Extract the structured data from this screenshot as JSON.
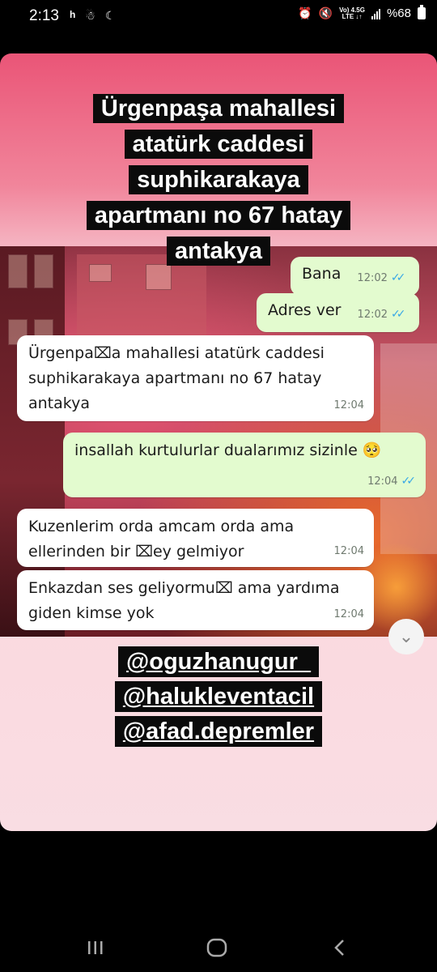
{
  "status_bar": {
    "time": "2:13",
    "network_top": "Vo) 4.5G",
    "network_bottom": "LTE ↓↑",
    "battery": "%68",
    "icons": [
      "h-icon",
      "baby-icon",
      "moon-icon",
      "alarm-icon",
      "mute-icon",
      "signal-icon",
      "battery-icon"
    ]
  },
  "story": {
    "title_lines": [
      "Ürgenpaşa mahallesi",
      "atatürk caddesi",
      "suphikarakaya",
      "apartmanı no 67 hatay",
      "antakya"
    ],
    "chat": {
      "messages": [
        {
          "dir": "out",
          "text": "Bana",
          "time": "12:02"
        },
        {
          "dir": "out",
          "text": "Adres ver",
          "time": "12:02"
        },
        {
          "dir": "in",
          "text": "Ürgenpa⌧a mahallesi atatürk caddesi suphikarakaya apartmanı no 67 hatay antakya",
          "time": "12:04"
        },
        {
          "dir": "out",
          "text": "insallah kurtulurlar dualarımız sizinle 🥺",
          "time": "12:04"
        },
        {
          "dir": "in",
          "text": "Kuzenlerim orda amcam orda ama ellerinden bir ⌧ey gelmiyor",
          "time": "12:04"
        },
        {
          "dir": "in",
          "text": "Enkazdan ses geliyormu⌧ ama yardıma giden kimse yok",
          "time": "12:04"
        }
      ],
      "read_ticks": "✓✓"
    },
    "handles": [
      "@oguzhanugur_",
      "@halukleventacil",
      "@afad.depremler"
    ]
  },
  "colors": {
    "out_bubble": "#e3fbcf",
    "in_bubble": "#ffffff",
    "read_tick": "#38a8e6",
    "label_bg": "#0b0b0b"
  }
}
